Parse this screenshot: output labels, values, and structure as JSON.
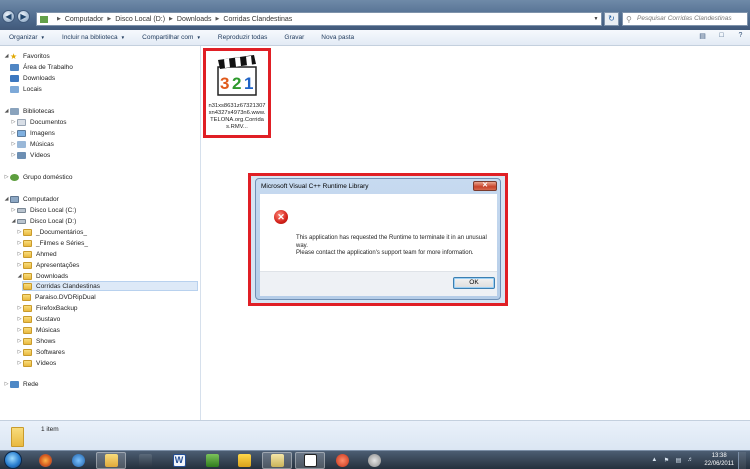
{
  "window": {
    "address_segments": [
      "Computador",
      "Disco Local (D:)",
      "Downloads",
      "Corridas Clandestinas"
    ],
    "search_placeholder": "Pesquisar Corridas Clandestinas"
  },
  "toolbar": {
    "organize": "Organizar",
    "include_library": "Incluir na biblioteca",
    "share": "Compartilhar com",
    "play_all": "Reproduzir todas",
    "burn": "Gravar",
    "new_folder": "Nova pasta"
  },
  "navigation": {
    "favorites": "Favoritos",
    "desktop": "Área de Trabalho",
    "downloads": "Downloads",
    "recent_places": "Locais",
    "libraries": "Bibliotecas",
    "documents": "Documentos",
    "images": "Imagens",
    "music": "Músicas",
    "videos": "Vídeos",
    "homegroup": "Grupo doméstico",
    "computer": "Computador",
    "disk_c": "Disco Local (C:)",
    "disk_d": "Disco Local (D:)",
    "folders": [
      "_Documentários_",
      "_Filmes e Séries_",
      "Ahmed",
      "Apresentações",
      "Downloads",
      "Corridas Clandestinas",
      "Paraiso.DVDRipDual",
      "FirefoxBackup",
      "Gustavo",
      "Músicas",
      "Shows",
      "Softwares",
      "Vídeos"
    ],
    "network": "Rede"
  },
  "content": {
    "file_name": "n31xs8631z67321307xn4327x4973n6.www.TELONA.org.Corridas.RMV..."
  },
  "dialog": {
    "title": "Microsoft Visual C++ Runtime Library",
    "close": "✕",
    "message_line1": "This application has requested the Runtime to terminate it in an unusual way.",
    "message_line2": "Please contact the application's support team for more information.",
    "ok": "OK"
  },
  "details": {
    "count": "1 item"
  },
  "taskbar": {
    "time": "13:38",
    "date": "22/06/2011"
  },
  "colors": {
    "highlight_border": "#e01f25",
    "titlebar": "#4f6b8e"
  }
}
